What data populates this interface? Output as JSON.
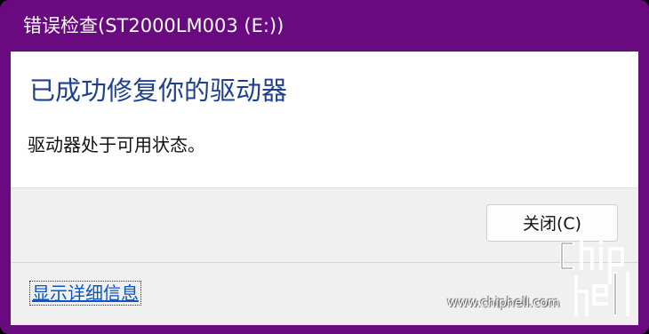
{
  "window": {
    "title": "错误检查(ST2000LM003 (E:))"
  },
  "content": {
    "heading": "已成功修复你的驱动器",
    "message": "驱动器处于可用状态。"
  },
  "footer": {
    "close_label": "关闭(C)",
    "details_link": "显示详细信息"
  },
  "watermark": {
    "url": "www.chiphell.com"
  },
  "colors": {
    "titlebar": "#6a0a80",
    "heading": "#1f3f8f",
    "link": "#0b55c4"
  }
}
